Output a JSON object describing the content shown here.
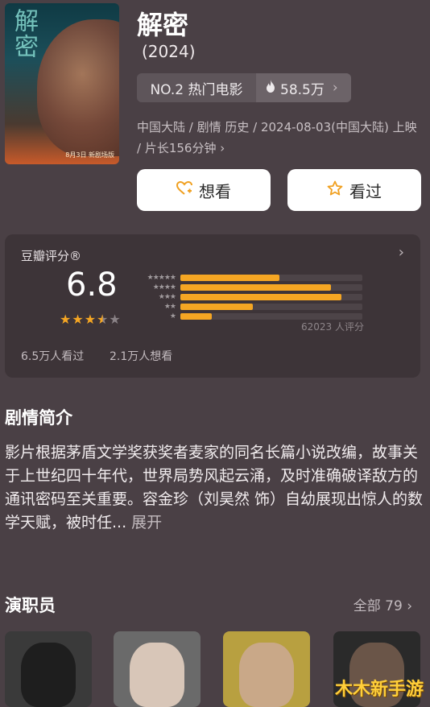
{
  "movie": {
    "title": "解密",
    "year": "(2024)",
    "rank": "NO.2 热门电影",
    "heat": "58.5万",
    "meta": "中国大陆 / 剧情 历史 / 2024-08-03(中国大陆) 上映 / 片长156分钟",
    "poster": {
      "title_art": "解密",
      "caption": "8月3日 新剧场版"
    }
  },
  "actions": {
    "want_label": "想看",
    "watched_label": "看过"
  },
  "rating": {
    "label": "豆瓣评分®",
    "score": "6.8",
    "stars_filled": 3.5,
    "stars_total": 5,
    "distribution": [
      0.19,
      0.29,
      0.31,
      0.14,
      0.06
    ],
    "count": "62023 人评分",
    "watched": "6.5万人看过",
    "wanted": "2.1万人想看"
  },
  "synopsis": {
    "heading": "剧情简介",
    "text": "影片根据茅盾文学奖获奖者麦家的同名长篇小说改编，故事关于上世纪四十年代，世界局势风起云涌，及时准确破译敌方的通讯密码至关重要。容金珍（刘昊然 饰）自幼展现出惊人的数学天赋，被时任...",
    "expand_label": "展开"
  },
  "cast": {
    "heading": "演职员",
    "all_label": "全部 79",
    "photo_colors": [
      "#3a3a3a",
      "#6a6a6a",
      "#b8a040",
      "#2a2a2a"
    ]
  },
  "watermark": "木木新手游",
  "colors": {
    "accent": "#f5a623",
    "background": "#4a4045"
  }
}
